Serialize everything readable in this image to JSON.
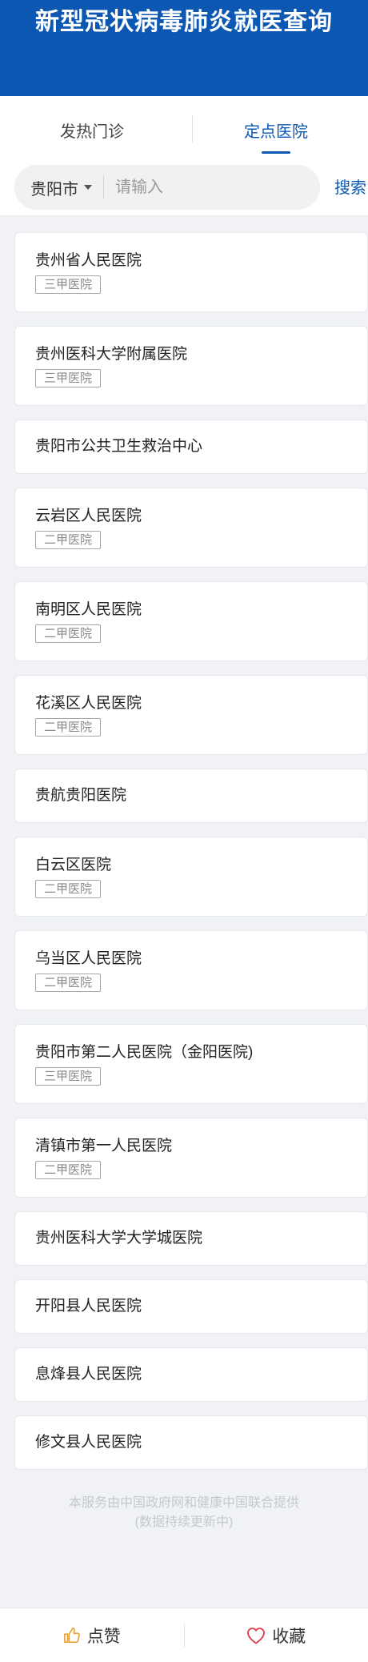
{
  "header": {
    "title": "新型冠状病毒肺炎就医查询"
  },
  "tabs": [
    {
      "label": "发热门诊",
      "active": false
    },
    {
      "label": "定点医院",
      "active": true
    }
  ],
  "search": {
    "city": "贵阳市",
    "placeholder": "请输入",
    "value": "",
    "button_label": "搜索"
  },
  "hospitals": [
    {
      "name": "贵州省人民医院",
      "level": "三甲医院"
    },
    {
      "name": "贵州医科大学附属医院",
      "level": "三甲医院"
    },
    {
      "name": "贵阳市公共卫生救治中心",
      "level": ""
    },
    {
      "name": "云岩区人民医院",
      "level": "二甲医院"
    },
    {
      "name": "南明区人民医院",
      "level": "二甲医院"
    },
    {
      "name": "花溪区人民医院",
      "level": "二甲医院"
    },
    {
      "name": "贵航贵阳医院",
      "level": ""
    },
    {
      "name": "白云区医院",
      "level": "二甲医院"
    },
    {
      "name": "乌当区人民医院",
      "level": "二甲医院"
    },
    {
      "name": "贵阳市第二人民医院（金阳医院)",
      "level": "三甲医院"
    },
    {
      "name": "清镇市第一人民医院",
      "level": "二甲医院"
    },
    {
      "name": "贵州医科大学大学城医院",
      "level": ""
    },
    {
      "name": "开阳县人民医院",
      "level": ""
    },
    {
      "name": "息烽县人民医院",
      "level": ""
    },
    {
      "name": "修文县人民医院",
      "level": ""
    }
  ],
  "footer": {
    "line1": "本服务由中国政府网和健康中国联合提供",
    "line2": "(数据持续更新中)"
  },
  "bottom_bar": {
    "like_label": "点赞",
    "like_icon": "thumbs-up-icon",
    "favorite_label": "收藏",
    "favorite_icon": "heart-icon",
    "like_icon_color": "#e8a33d",
    "favorite_icon_color": "#e0364b"
  },
  "colors": {
    "brand": "#0b57b1",
    "background": "#f0f2f5"
  }
}
